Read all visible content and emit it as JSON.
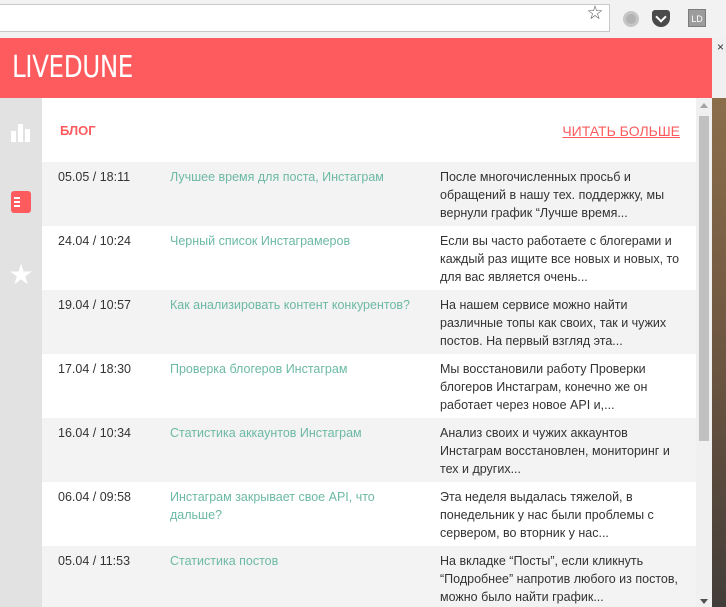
{
  "browser": {
    "bookmark_icon": "star-outline-icon",
    "ext_ld_label": "LD",
    "close_glyph": "×"
  },
  "app": {
    "logo": "LIVEDUNE",
    "accent_color": "#fe5b5f",
    "link_color": "#6cb9a5",
    "nav": [
      "stats-icon",
      "blog-icon",
      "star-icon"
    ]
  },
  "blog": {
    "title": "БЛОГ",
    "read_more": "ЧИТАТЬ БОЛЬШЕ",
    "posts": [
      {
        "date": "05.05 / 18:11",
        "title": "Лучшее время для поста, Инстаграм",
        "desc": "После многочисленных просьб и обращений в нашу тех. поддержку, мы вернули график “Лучше время..."
      },
      {
        "date": "24.04 / 10:24",
        "title": "Черный список Инстаграмеров",
        "desc": "Если вы часто работаете с блогерами и каждый раз ищите все новых и новых, то для вас является очень..."
      },
      {
        "date": "19.04 / 10:57",
        "title": "Как анализировать контент конкурентов?",
        "desc": "На нашем сервисе можно найти различные топы как своих, так и чужих постов. На первый взгляд эта..."
      },
      {
        "date": "17.04 / 18:30",
        "title": "Проверка блогеров Инстаграм",
        "desc": "Мы восстановили работу Проверки блогеров Инстаграм, конечно же он работает через новое API и,..."
      },
      {
        "date": "16.04 / 10:34",
        "title": "Статистика аккаунтов Инстаграм",
        "desc": "Анализ своих и чужих аккаунтов Инстаграм восстановлен, мониторинг и тех и других..."
      },
      {
        "date": "06.04 / 09:58",
        "title": "Инстаграм закрывает свое API, что дальше?",
        "desc": "Эта неделя выдалась тяжелой, в понедельник у нас были проблемы с сервером, во вторник у нас..."
      },
      {
        "date": "05.04 / 11:53",
        "title": "Статистика постов",
        "desc": "На вкладке “Посты”, если кликнуть “Подробнее” напротив любого из постов, можно было найти график..."
      }
    ]
  }
}
